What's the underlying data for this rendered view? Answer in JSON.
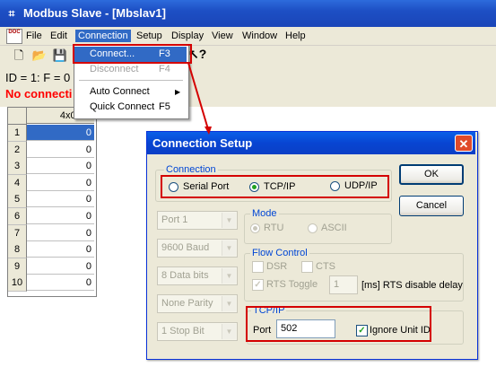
{
  "window": {
    "title": "Modbus Slave - [Mbslav1]",
    "app_icon_glyph": "⌗"
  },
  "menubar": {
    "doc_icon": "DOC",
    "items": [
      "File",
      "Edit",
      "Connection",
      "Setup",
      "Display",
      "View",
      "Window",
      "Help"
    ]
  },
  "toolbar": {
    "icons": [
      "new-icon",
      "open-icon",
      "save-icon",
      "help-icon"
    ]
  },
  "status": {
    "id_line": "ID = 1: F = 0",
    "connection_line": "No connecti"
  },
  "grid": {
    "header": "4x0000",
    "rows": [
      {
        "num": "1",
        "value": "0"
      },
      {
        "num": "2",
        "value": "0"
      },
      {
        "num": "3",
        "value": "0"
      },
      {
        "num": "4",
        "value": "0"
      },
      {
        "num": "5",
        "value": "0"
      },
      {
        "num": "6",
        "value": "0"
      },
      {
        "num": "7",
        "value": "0"
      },
      {
        "num": "8",
        "value": "0"
      },
      {
        "num": "9",
        "value": "0"
      },
      {
        "num": "10",
        "value": "0"
      }
    ]
  },
  "connection_menu": {
    "connect": {
      "label": "Connect...",
      "shortcut": "F3"
    },
    "disconnect": {
      "label": "Disconnect",
      "shortcut": "F4"
    },
    "auto_connect": {
      "label": "Auto Connect"
    },
    "quick_connect": {
      "label": "Quick Connect",
      "shortcut": "F5"
    }
  },
  "dialog": {
    "title": "Connection Setup",
    "close_glyph": "✕",
    "connection_group": {
      "label": "Connection",
      "options": [
        "Serial Port",
        "TCP/IP",
        "UDP/IP"
      ],
      "selected": "TCP/IP"
    },
    "ok_label": "OK",
    "cancel_label": "Cancel",
    "serial_combos": [
      "Port 1",
      "9600 Baud",
      "8 Data bits",
      "None Parity",
      "1 Stop Bit"
    ],
    "mode_group": {
      "label": "Mode",
      "options": [
        "RTU",
        "ASCII"
      ],
      "selected": "RTU"
    },
    "flow_group": {
      "label": "Flow Control",
      "dsr": "DSR",
      "cts": "CTS",
      "rts_toggle": "RTS Toggle",
      "rts_delay_value": "1",
      "rts_delay_label": "[ms] RTS disable delay"
    },
    "tcpip_group": {
      "label": "TCP/IP",
      "port_label": "Port",
      "port_value": "502",
      "ignore_unit_id": "Ignore Unit ID",
      "ignore_unit_id_checked": true
    }
  },
  "colors": {
    "highlight": "#316ac5",
    "annotation_red": "#d40000",
    "status_red": "#ff0000"
  }
}
